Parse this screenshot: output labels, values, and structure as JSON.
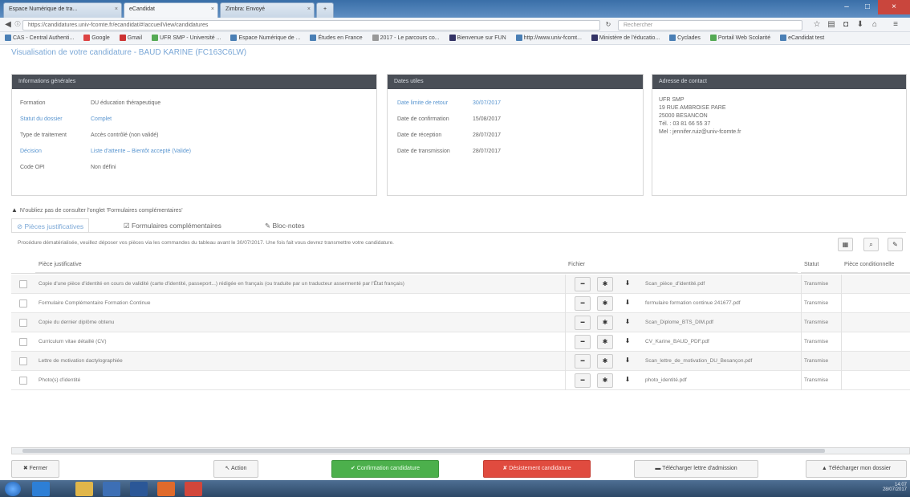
{
  "browser": {
    "tabs": [
      {
        "label": "Espace Numérique de tra..."
      },
      {
        "label": "eCandidat"
      },
      {
        "label": "Zimbra: Envoyé"
      }
    ],
    "url": "https://candidatures.univ-fcomte.fr/ecandidat/#!accueilView/candidatures",
    "search_placeholder": "Rechercher",
    "bookmarks": [
      "CAS - Central Authenti...",
      "Google",
      "Gmail",
      "UFR SMP - Université ...",
      "Espace Numérique de ...",
      "Études en France",
      "2017 - Le parcours co...",
      "Bienvenue sur FUN",
      "http://www.univ-fcomt...",
      "Ministère de l'éducatio...",
      "Cyclades",
      "Portail Web Scolarité",
      "eCandidat test"
    ]
  },
  "page": {
    "title": "Visualisation de votre candidature - BAUD KARINE (FC163C6LW)"
  },
  "panels": {
    "info": {
      "title": "Informations générales",
      "rows": [
        {
          "key": "Formation",
          "value": "DU éducation thérapeutique"
        },
        {
          "key": "Statut du dossier",
          "value": "Complet"
        },
        {
          "key": "Type de traitement",
          "value": "Accès contrôlé (non validé)"
        },
        {
          "key": "Décision",
          "value": "Liste d'attente – Bientôt accepté (Valide)"
        },
        {
          "key": "Code OPI",
          "value": "Non défini"
        }
      ]
    },
    "dates": {
      "title": "Dates utiles",
      "rows": [
        {
          "key": "Date limite de retour",
          "value": "30/07/2017"
        },
        {
          "key": "Date de confirmation",
          "value": "15/08/2017"
        },
        {
          "key": "Date de réception",
          "value": "28/07/2017"
        },
        {
          "key": "Date de transmission",
          "value": "28/07/2017"
        }
      ]
    },
    "address": {
      "title": "Adresse de contact",
      "lines": [
        "UFR SMP",
        "19 RUE AMBROISE PARE",
        "25000 BESANCON",
        "Tél. : 03 81 66 55 37",
        "Mel : jennifer.ruiz@univ-fcomte.fr"
      ]
    }
  },
  "warning": "N'oubliez pas de consulter l'onglet 'Formulaires complémentaires'",
  "tabs": [
    {
      "label": "Pièces justificatives"
    },
    {
      "label": "Formulaires complémentaires"
    },
    {
      "label": "Bloc-notes"
    }
  ],
  "procedure_text": "Procédure dématérialisée, veuillez déposer vos pièces via les commandes du tableau avant le 30/07/2017. Une fois fait vous devrez transmettre votre candidature.",
  "table": {
    "headers": {
      "piece": "Pièce justificative",
      "fichier": "Fichier",
      "statut": "Statut",
      "conditionnelle": "Pièce conditionnelle"
    },
    "rows": [
      {
        "piece": "Copie d'une pièce d'identité en cours de validité (carte d'identité, passeport...) rédigée en français (ou traduite par un traducteur assermenté par l'État français)",
        "file": "Scan_pièce_d'identité.pdf",
        "status": "Transmise"
      },
      {
        "piece": "Formulaire Complémentaire Formation Continue",
        "file": "formulaire formation continue 241677.pdf",
        "status": "Transmise"
      },
      {
        "piece": "Copie du dernier diplôme obtenu",
        "file": "Scan_Diplome_BTS_DIM.pdf",
        "status": "Transmise"
      },
      {
        "piece": "Curriculum vitae détaillé (CV)",
        "file": "CV_Karine_BAUD_PDF.pdf",
        "status": "Transmise"
      },
      {
        "piece": "Lettre de motivation dactylographiée",
        "file": "Scan_lettre_de_motivation_DU_Besançon.pdf",
        "status": "Transmise"
      },
      {
        "piece": "Photo(s) d'identité",
        "file": "photo_identité.pdf",
        "status": "Transmise"
      }
    ]
  },
  "footer": {
    "close": "Fermer",
    "action": "Action",
    "confirm": "Confirmation candidature",
    "withdraw": "Désistement candidature",
    "download_admission": "Télécharger lettre d'admission",
    "download_file": "Télécharger mon dossier"
  },
  "taskbar": {
    "time": "14:07",
    "date": "28/07/2017"
  }
}
